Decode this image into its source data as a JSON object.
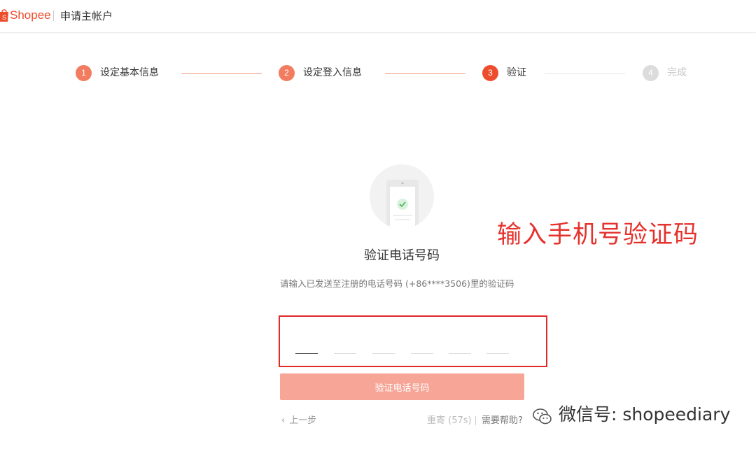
{
  "header": {
    "brand": "Shopee",
    "title": "申请主帐户"
  },
  "colors": {
    "brand": "#ee4d2d",
    "annotation": "#e5322d",
    "button": "#f6a596"
  },
  "steps": [
    {
      "num": "1",
      "label": "设定基本信息",
      "state": "done"
    },
    {
      "num": "2",
      "label": "设定登入信息",
      "state": "done"
    },
    {
      "num": "3",
      "label": "验证",
      "state": "active"
    },
    {
      "num": "4",
      "label": "完成",
      "state": "pending"
    }
  ],
  "annotation": "输入手机号验证码",
  "verify": {
    "title": "验证电话号码",
    "description": "请输入已发送至注册的电话号码 (+86****3506)里的验证码",
    "submit_label": "验证电话号码",
    "back_label": "上一步",
    "resend_label": "重寄 (57s)",
    "help_label": "需要帮助?"
  },
  "watermark": {
    "icon": "wechat-icon",
    "text": "微信号: shopeediary"
  }
}
